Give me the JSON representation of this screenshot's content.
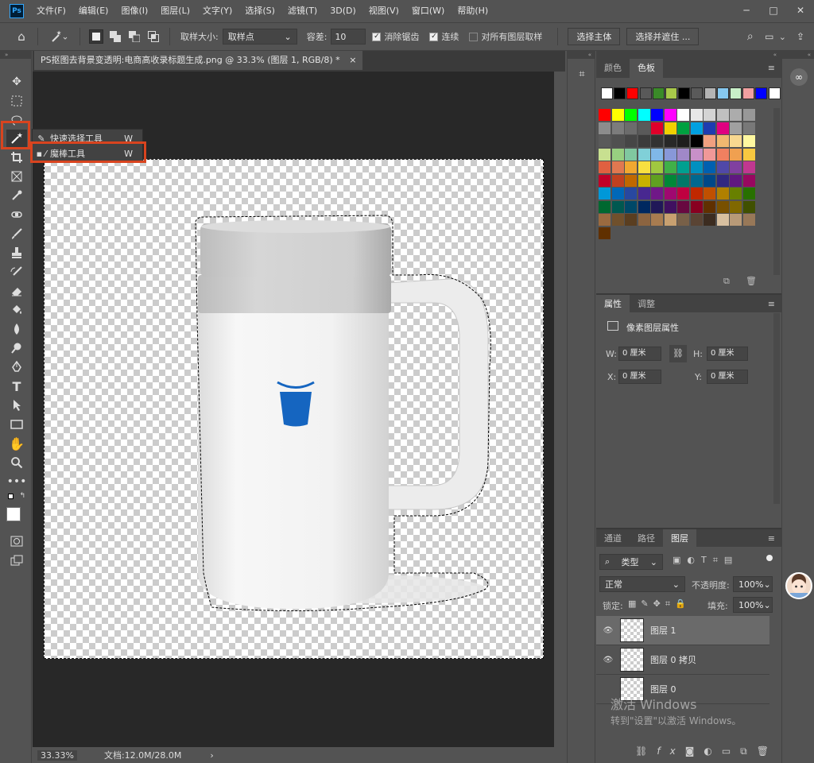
{
  "app": {
    "logo": "Ps"
  },
  "menu": [
    "文件(F)",
    "编辑(E)",
    "图像(I)",
    "图层(L)",
    "文字(Y)",
    "选择(S)",
    "滤镜(T)",
    "3D(D)",
    "视图(V)",
    "窗口(W)",
    "帮助(H)"
  ],
  "window_controls": {
    "minimize": "─",
    "restore": "□",
    "close": "✕"
  },
  "options": {
    "sample_size_label": "取样大小:",
    "sample_size_value": "取样点",
    "tolerance_label": "容差:",
    "tolerance_value": "10",
    "antialias_label": "消除锯齿",
    "contiguous_label": "连续",
    "all_layers_label": "对所有图层取样",
    "select_subject": "选择主体",
    "select_mask": "选择并遮住 ..."
  },
  "document": {
    "tab_title": "PS抠图去背景变透明:电商高收录标题生成.png @ 33.3% (图层 1, RGB/8) *",
    "close": "×",
    "zoom": "33.33%",
    "doc_info": "文档:12.0M/28.0M",
    "arrow": "›"
  },
  "flyout": {
    "quick_select": "快速选择工具",
    "quick_select_key": "W",
    "magic_wand": "魔棒工具",
    "magic_wand_key": "W"
  },
  "swatches_panel": {
    "tab_color": "颜色",
    "tab_swatches": "色板",
    "recent": [
      "#ffffff",
      "#000000",
      "#ff0000",
      "#595959",
      "#3a8a28",
      "#a8c84a",
      "#000000",
      "#5a5a5a",
      "#b4b4b4",
      "#86c8f0",
      "#c8f0c8",
      "#f0a0a0",
      "#0000ff",
      "#ffffff"
    ],
    "grid": [
      [
        "#ff0000",
        "#ffff00",
        "#00ff00",
        "#00ffff",
        "#0000ff",
        "#ff00ff",
        "#ffffff",
        "#e8e8e8",
        "#d4d4d4",
        "#c0c0c0",
        "#acacac",
        "#989898"
      ],
      [
        "#8c8c8c",
        "#7c7c7c",
        "#6c6c6c",
        "#5a5a5a",
        "#e0002a",
        "#f0d000",
        "#00a040",
        "#00a0e0",
        "#1e3cb0",
        "#e00080",
        "#a0a0a0",
        "#787878"
      ],
      [
        "#5a5a5a",
        "#505050",
        "#464646",
        "#3c3c3c",
        "#323232",
        "#282828",
        "#1e1e1e",
        "#000000",
        "#f0a080",
        "#f0b870",
        "#f8d890",
        "#fff8a0"
      ],
      [
        "#c8e090",
        "#98d080",
        "#80c8a0",
        "#80d0d8",
        "#80b8e8",
        "#8898d8",
        "#a088c8",
        "#c890c8",
        "#f09898",
        "#f08060",
        "#f0a050",
        "#f8c840"
      ],
      [
        "#e06040",
        "#e07850",
        "#f0a830",
        "#f8e040",
        "#a0c840",
        "#40b048",
        "#00a090",
        "#0090c0",
        "#0060b0",
        "#5048a8",
        "#8040a0",
        "#c03890"
      ],
      [
        "#c00028",
        "#c04020",
        "#c06800",
        "#c8b000",
        "#60a020",
        "#008838",
        "#007868",
        "#006890",
        "#004888",
        "#302880",
        "#601880",
        "#980860"
      ],
      [
        "#0098d8",
        "#0068b8",
        "#2848a0",
        "#482890",
        "#701888",
        "#a00870",
        "#c00040",
        "#c02800",
        "#c05000",
        "#b08000",
        "#688000",
        "#287000"
      ],
      [
        "#006830",
        "#005850",
        "#004868",
        "#002860",
        "#201858",
        "#401060",
        "#680840",
        "#880020",
        "#603000",
        "#785000",
        "#806800",
        "#405000"
      ],
      [
        "#9a6a40",
        "#70502c",
        "#5a3e20",
        "#8c6440",
        "#a87c50",
        "#c8a070",
        "#786048",
        "#5a4434",
        "#3c2c20",
        "#d8c0a0",
        "#b89a78",
        "#987858"
      ],
      [
        "#603000"
      ]
    ]
  },
  "properties_panel": {
    "tab_properties": "属性",
    "tab_adjust": "调整",
    "header": "像素图层属性",
    "w_label": "W:",
    "w_value": "0 厘米",
    "h_label": "H:",
    "h_value": "0 厘米",
    "x_label": "X:",
    "x_value": "0 厘米",
    "y_label": "Y:",
    "y_value": "0 厘米"
  },
  "layers_panel": {
    "tab_channels": "通道",
    "tab_paths": "路径",
    "tab_layers": "图层",
    "filter_kind": "类型",
    "blend_mode": "正常",
    "opacity_label": "不透明度:",
    "opacity_value": "100%",
    "lock_label": "锁定:",
    "fill_label": "填充:",
    "fill_value": "100%",
    "layers": [
      {
        "name": "图层 1",
        "visible": true,
        "selected": true
      },
      {
        "name": "图层 0 拷贝",
        "visible": true,
        "selected": false
      },
      {
        "name": "图层 0",
        "visible": false,
        "selected": false
      }
    ]
  },
  "watermark": {
    "line1": "激活 Windows",
    "line2": "转到\"设置\"以激活 Windows。"
  },
  "colors": {
    "selection_red": "#d9441f",
    "cup_logo_blue": "#1565c0"
  }
}
